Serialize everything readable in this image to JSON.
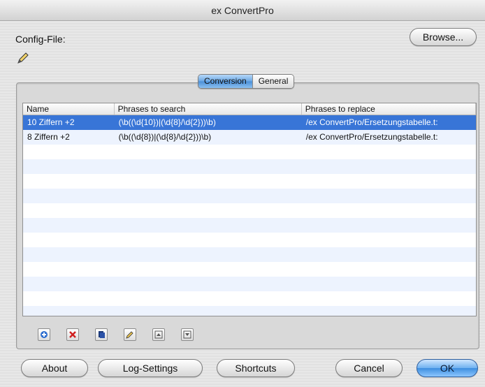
{
  "window": {
    "title": "ex ConvertPro"
  },
  "config": {
    "label": "Config-File:",
    "browse_label": "Browse..."
  },
  "tabs": [
    {
      "label": "Conversion",
      "active": true
    },
    {
      "label": "General",
      "active": false
    }
  ],
  "table": {
    "columns": [
      "Name",
      "Phrases to search",
      "Phrases to replace"
    ],
    "rows": [
      {
        "name": "10 Ziffern +2",
        "search": "(\\b((\\d{10})|(\\d{8}/\\d{2}))\\b)",
        "replace": "/ex ConvertPro/Ersetzungstabelle.t:",
        "selected": true
      },
      {
        "name": "8 Ziffern +2",
        "search": "(\\b((\\d{8})|(\\d{8}/\\d{2}))\\b)",
        "replace": "/ex ConvertPro/Ersetzungstabelle.t:",
        "selected": false
      }
    ]
  },
  "toolbar_icons": [
    "add-icon",
    "delete-icon",
    "duplicate-icon",
    "edit-pencil-icon",
    "move-up-icon",
    "move-down-icon"
  ],
  "buttons": {
    "about": "About",
    "log_settings": "Log-Settings",
    "shortcuts": "Shortcuts",
    "cancel": "Cancel",
    "ok": "OK"
  },
  "colors": {
    "accent": "#3875d7",
    "ok_button": "#4a9be8"
  }
}
